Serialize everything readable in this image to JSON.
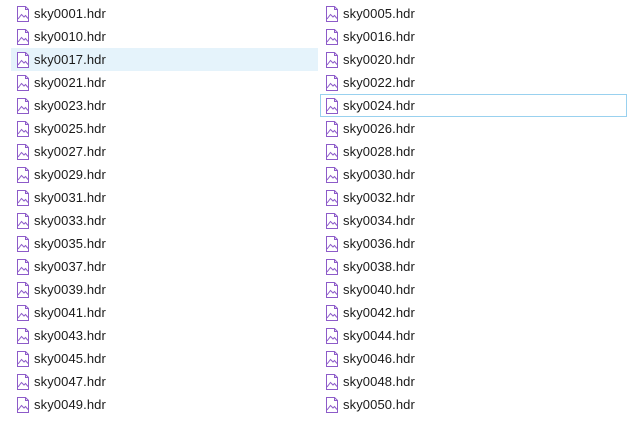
{
  "files": {
    "left": [
      {
        "name": "sky0001.hdr",
        "icon": "image-file-icon",
        "state": "normal"
      },
      {
        "name": "sky0010.hdr",
        "icon": "image-file-icon",
        "state": "normal"
      },
      {
        "name": "sky0017.hdr",
        "icon": "image-file-icon",
        "state": "selected"
      },
      {
        "name": "sky0021.hdr",
        "icon": "image-file-icon",
        "state": "normal"
      },
      {
        "name": "sky0023.hdr",
        "icon": "image-file-icon",
        "state": "normal"
      },
      {
        "name": "sky0025.hdr",
        "icon": "image-file-icon",
        "state": "normal"
      },
      {
        "name": "sky0027.hdr",
        "icon": "image-file-icon",
        "state": "normal"
      },
      {
        "name": "sky0029.hdr",
        "icon": "image-file-icon",
        "state": "normal"
      },
      {
        "name": "sky0031.hdr",
        "icon": "image-file-icon",
        "state": "normal"
      },
      {
        "name": "sky0033.hdr",
        "icon": "image-file-icon",
        "state": "normal"
      },
      {
        "name": "sky0035.hdr",
        "icon": "image-file-icon",
        "state": "normal"
      },
      {
        "name": "sky0037.hdr",
        "icon": "image-file-icon",
        "state": "normal"
      },
      {
        "name": "sky0039.hdr",
        "icon": "image-file-icon",
        "state": "normal"
      },
      {
        "name": "sky0041.hdr",
        "icon": "image-file-icon",
        "state": "normal"
      },
      {
        "name": "sky0043.hdr",
        "icon": "image-file-icon",
        "state": "normal"
      },
      {
        "name": "sky0045.hdr",
        "icon": "image-file-icon",
        "state": "normal"
      },
      {
        "name": "sky0047.hdr",
        "icon": "image-file-icon",
        "state": "normal"
      },
      {
        "name": "sky0049.hdr",
        "icon": "image-file-icon",
        "state": "normal"
      }
    ],
    "right": [
      {
        "name": "sky0005.hdr",
        "icon": "image-file-icon",
        "state": "normal"
      },
      {
        "name": "sky0016.hdr",
        "icon": "image-file-icon",
        "state": "normal"
      },
      {
        "name": "sky0020.hdr",
        "icon": "image-file-icon",
        "state": "normal"
      },
      {
        "name": "sky0022.hdr",
        "icon": "image-file-icon",
        "state": "normal"
      },
      {
        "name": "sky0024.hdr",
        "icon": "image-file-icon",
        "state": "focused"
      },
      {
        "name": "sky0026.hdr",
        "icon": "image-file-icon",
        "state": "normal"
      },
      {
        "name": "sky0028.hdr",
        "icon": "image-file-icon",
        "state": "normal"
      },
      {
        "name": "sky0030.hdr",
        "icon": "image-file-icon",
        "state": "normal"
      },
      {
        "name": "sky0032.hdr",
        "icon": "image-file-icon",
        "state": "normal"
      },
      {
        "name": "sky0034.hdr",
        "icon": "image-file-icon",
        "state": "normal"
      },
      {
        "name": "sky0036.hdr",
        "icon": "image-file-icon",
        "state": "normal"
      },
      {
        "name": "sky0038.hdr",
        "icon": "image-file-icon",
        "state": "normal"
      },
      {
        "name": "sky0040.hdr",
        "icon": "image-file-icon",
        "state": "normal"
      },
      {
        "name": "sky0042.hdr",
        "icon": "image-file-icon",
        "state": "normal"
      },
      {
        "name": "sky0044.hdr",
        "icon": "image-file-icon",
        "state": "normal"
      },
      {
        "name": "sky0046.hdr",
        "icon": "image-file-icon",
        "state": "normal"
      },
      {
        "name": "sky0048.hdr",
        "icon": "image-file-icon",
        "state": "normal"
      },
      {
        "name": "sky0050.hdr",
        "icon": "image-file-icon",
        "state": "normal"
      }
    ]
  },
  "colors": {
    "icon_stroke": "#8d5bc9",
    "icon_fill": "#ffffff",
    "selected_bg": "#e5f3fb",
    "focus_border": "#99d1ef",
    "text": "#1a1a1a"
  }
}
